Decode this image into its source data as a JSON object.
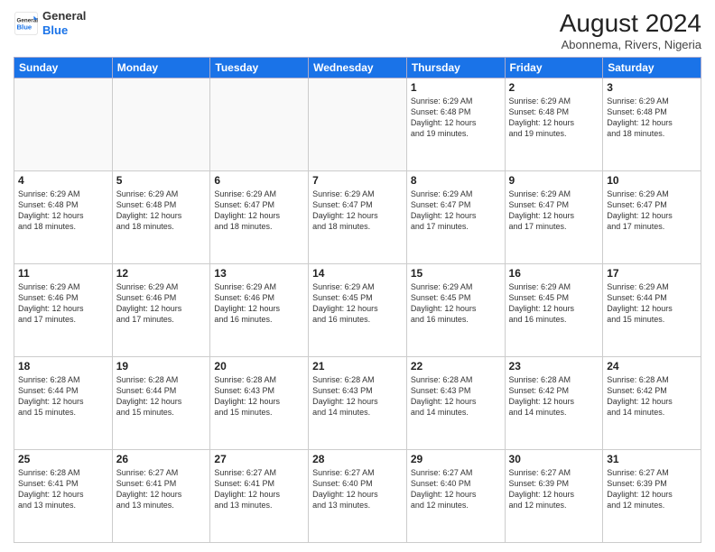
{
  "header": {
    "logo_line1": "General",
    "logo_line2": "Blue",
    "month_year": "August 2024",
    "location": "Abonnema, Rivers, Nigeria"
  },
  "days_of_week": [
    "Sunday",
    "Monday",
    "Tuesday",
    "Wednesday",
    "Thursday",
    "Friday",
    "Saturday"
  ],
  "weeks": [
    [
      {
        "day": "",
        "info": ""
      },
      {
        "day": "",
        "info": ""
      },
      {
        "day": "",
        "info": ""
      },
      {
        "day": "",
        "info": ""
      },
      {
        "day": "1",
        "info": "Sunrise: 6:29 AM\nSunset: 6:48 PM\nDaylight: 12 hours\nand 19 minutes."
      },
      {
        "day": "2",
        "info": "Sunrise: 6:29 AM\nSunset: 6:48 PM\nDaylight: 12 hours\nand 19 minutes."
      },
      {
        "day": "3",
        "info": "Sunrise: 6:29 AM\nSunset: 6:48 PM\nDaylight: 12 hours\nand 18 minutes."
      }
    ],
    [
      {
        "day": "4",
        "info": "Sunrise: 6:29 AM\nSunset: 6:48 PM\nDaylight: 12 hours\nand 18 minutes."
      },
      {
        "day": "5",
        "info": "Sunrise: 6:29 AM\nSunset: 6:48 PM\nDaylight: 12 hours\nand 18 minutes."
      },
      {
        "day": "6",
        "info": "Sunrise: 6:29 AM\nSunset: 6:47 PM\nDaylight: 12 hours\nand 18 minutes."
      },
      {
        "day": "7",
        "info": "Sunrise: 6:29 AM\nSunset: 6:47 PM\nDaylight: 12 hours\nand 18 minutes."
      },
      {
        "day": "8",
        "info": "Sunrise: 6:29 AM\nSunset: 6:47 PM\nDaylight: 12 hours\nand 17 minutes."
      },
      {
        "day": "9",
        "info": "Sunrise: 6:29 AM\nSunset: 6:47 PM\nDaylight: 12 hours\nand 17 minutes."
      },
      {
        "day": "10",
        "info": "Sunrise: 6:29 AM\nSunset: 6:47 PM\nDaylight: 12 hours\nand 17 minutes."
      }
    ],
    [
      {
        "day": "11",
        "info": "Sunrise: 6:29 AM\nSunset: 6:46 PM\nDaylight: 12 hours\nand 17 minutes."
      },
      {
        "day": "12",
        "info": "Sunrise: 6:29 AM\nSunset: 6:46 PM\nDaylight: 12 hours\nand 17 minutes."
      },
      {
        "day": "13",
        "info": "Sunrise: 6:29 AM\nSunset: 6:46 PM\nDaylight: 12 hours\nand 16 minutes."
      },
      {
        "day": "14",
        "info": "Sunrise: 6:29 AM\nSunset: 6:45 PM\nDaylight: 12 hours\nand 16 minutes."
      },
      {
        "day": "15",
        "info": "Sunrise: 6:29 AM\nSunset: 6:45 PM\nDaylight: 12 hours\nand 16 minutes."
      },
      {
        "day": "16",
        "info": "Sunrise: 6:29 AM\nSunset: 6:45 PM\nDaylight: 12 hours\nand 16 minutes."
      },
      {
        "day": "17",
        "info": "Sunrise: 6:29 AM\nSunset: 6:44 PM\nDaylight: 12 hours\nand 15 minutes."
      }
    ],
    [
      {
        "day": "18",
        "info": "Sunrise: 6:28 AM\nSunset: 6:44 PM\nDaylight: 12 hours\nand 15 minutes."
      },
      {
        "day": "19",
        "info": "Sunrise: 6:28 AM\nSunset: 6:44 PM\nDaylight: 12 hours\nand 15 minutes."
      },
      {
        "day": "20",
        "info": "Sunrise: 6:28 AM\nSunset: 6:43 PM\nDaylight: 12 hours\nand 15 minutes."
      },
      {
        "day": "21",
        "info": "Sunrise: 6:28 AM\nSunset: 6:43 PM\nDaylight: 12 hours\nand 14 minutes."
      },
      {
        "day": "22",
        "info": "Sunrise: 6:28 AM\nSunset: 6:43 PM\nDaylight: 12 hours\nand 14 minutes."
      },
      {
        "day": "23",
        "info": "Sunrise: 6:28 AM\nSunset: 6:42 PM\nDaylight: 12 hours\nand 14 minutes."
      },
      {
        "day": "24",
        "info": "Sunrise: 6:28 AM\nSunset: 6:42 PM\nDaylight: 12 hours\nand 14 minutes."
      }
    ],
    [
      {
        "day": "25",
        "info": "Sunrise: 6:28 AM\nSunset: 6:41 PM\nDaylight: 12 hours\nand 13 minutes."
      },
      {
        "day": "26",
        "info": "Sunrise: 6:27 AM\nSunset: 6:41 PM\nDaylight: 12 hours\nand 13 minutes."
      },
      {
        "day": "27",
        "info": "Sunrise: 6:27 AM\nSunset: 6:41 PM\nDaylight: 12 hours\nand 13 minutes."
      },
      {
        "day": "28",
        "info": "Sunrise: 6:27 AM\nSunset: 6:40 PM\nDaylight: 12 hours\nand 13 minutes."
      },
      {
        "day": "29",
        "info": "Sunrise: 6:27 AM\nSunset: 6:40 PM\nDaylight: 12 hours\nand 12 minutes."
      },
      {
        "day": "30",
        "info": "Sunrise: 6:27 AM\nSunset: 6:39 PM\nDaylight: 12 hours\nand 12 minutes."
      },
      {
        "day": "31",
        "info": "Sunrise: 6:27 AM\nSunset: 6:39 PM\nDaylight: 12 hours\nand 12 minutes."
      }
    ]
  ]
}
